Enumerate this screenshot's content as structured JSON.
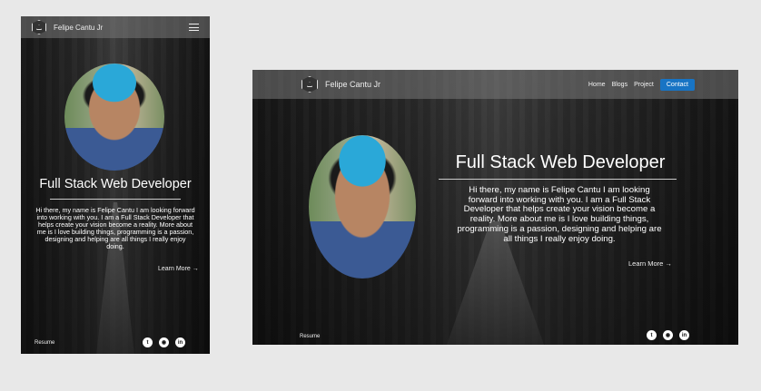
{
  "brand": "Felipe Cantu Jr",
  "nav": {
    "home": "Home",
    "blogs": "Blogs",
    "project": "Project",
    "contact": "Contact"
  },
  "hero": {
    "title": "Full Stack  Web Developer",
    "bio": "Hi there, my name is Felipe Cantu I am looking forward into working with you. I am a Full Stack Developer that helps create your vision become a reality. More about me is I love building things, programming is a passion, designing and helping are all things I really enjoy doing.",
    "learn_more": "Learn More →"
  },
  "footer": {
    "resume": "Resume"
  },
  "socials": [
    "twitter-icon",
    "github-icon",
    "linkedin-icon"
  ],
  "colors": {
    "accent": "#1874c4",
    "page_bg": "#e8e8e8"
  }
}
